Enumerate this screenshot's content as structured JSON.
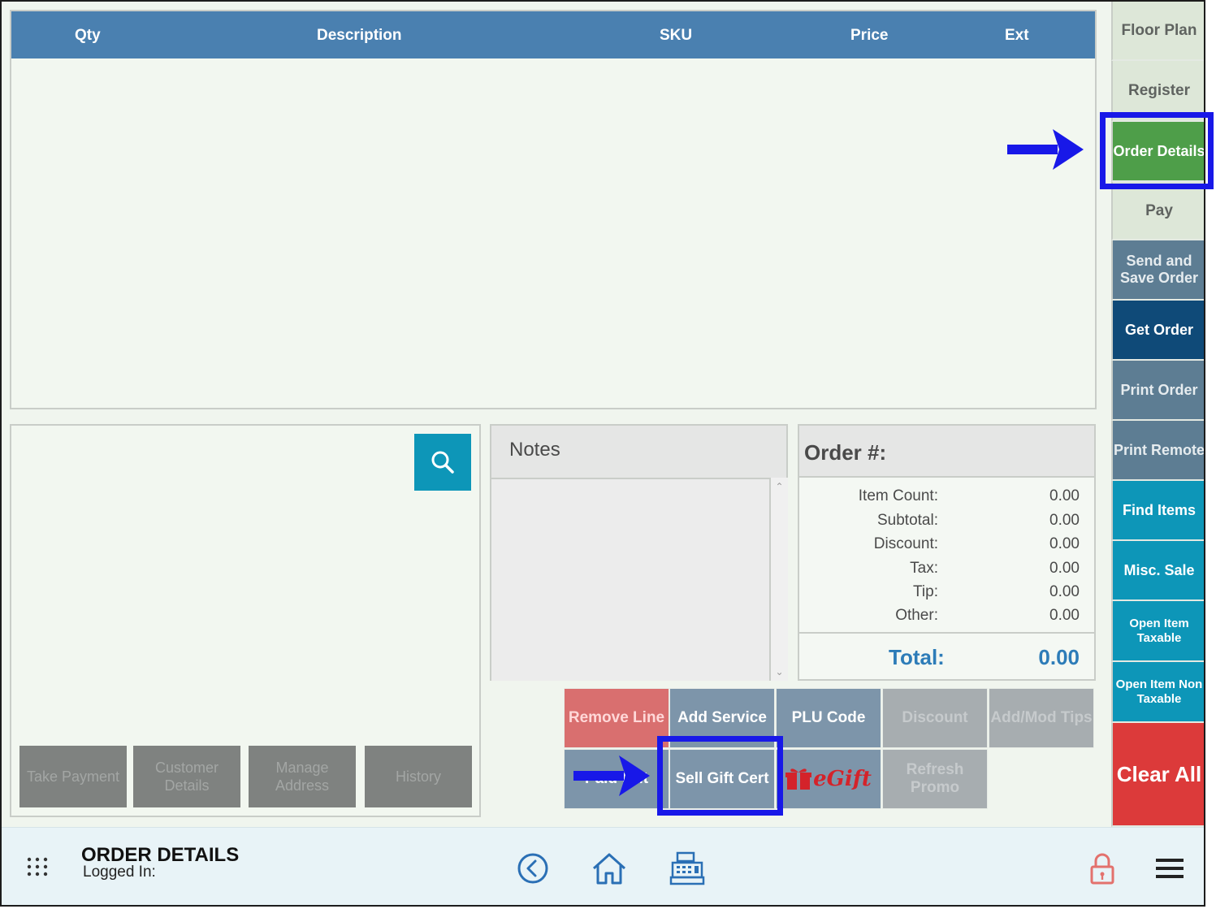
{
  "table": {
    "columns": [
      "Qty",
      "Description",
      "SKU",
      "Price",
      "Ext"
    ]
  },
  "customer_panel": {
    "buttons": [
      "Take Payment",
      "Customer Details",
      "Manage Address",
      "History"
    ]
  },
  "notes": {
    "title": "Notes",
    "value": ""
  },
  "summary": {
    "order_label": "Order #:",
    "rows": [
      {
        "label": "Item Count:",
        "value": "0.00"
      },
      {
        "label": "Subtotal:",
        "value": "0.00"
      },
      {
        "label": "Discount:",
        "value": "0.00"
      },
      {
        "label": "Tax:",
        "value": "0.00"
      },
      {
        "label": "Tip:",
        "value": "0.00"
      },
      {
        "label": "Other:",
        "value": "0.00"
      }
    ],
    "total_label": "Total:",
    "total_value": "0.00"
  },
  "actions": {
    "remove_line": "Remove Line",
    "add_service": "Add Service",
    "plu_code": "PLU Code",
    "discount": "Discount",
    "add_mod_tips": "Add/Mod Tips",
    "paid_out": "Paid Out",
    "sell_gift_cert": "Sell Gift Cert",
    "egift": "eGift",
    "refresh_promo": "Refresh Promo"
  },
  "sidebar": {
    "items": [
      {
        "label": "Floor Plan"
      },
      {
        "label": "Register"
      },
      {
        "label": "Order Details"
      },
      {
        "label": "Pay"
      },
      {
        "label": "Send and Save Order"
      },
      {
        "label": "Get Order"
      },
      {
        "label": "Print Order"
      },
      {
        "label": "Print Remote"
      },
      {
        "label": "Find Items"
      },
      {
        "label": "Misc. Sale"
      },
      {
        "label": "Open Item Taxable"
      },
      {
        "label": "Open Item Non Taxable"
      },
      {
        "label": "Clear All"
      }
    ]
  },
  "bottom_bar": {
    "title": "ORDER DETAILS",
    "logged_in_label": "Logged In:",
    "icons": [
      "apps-grid-icon",
      "back-icon",
      "home-icon",
      "cash-register-icon",
      "lock-icon",
      "hamburger-menu-icon"
    ]
  },
  "colors": {
    "header_blue": "#4a80b0",
    "teal": "#0d96b8",
    "navy": "#0f4a78",
    "active_green": "#4e9e49",
    "clear_red": "#dc3a3a",
    "annotation_blue": "#1818e8",
    "total_blue": "#2d7cb8"
  }
}
